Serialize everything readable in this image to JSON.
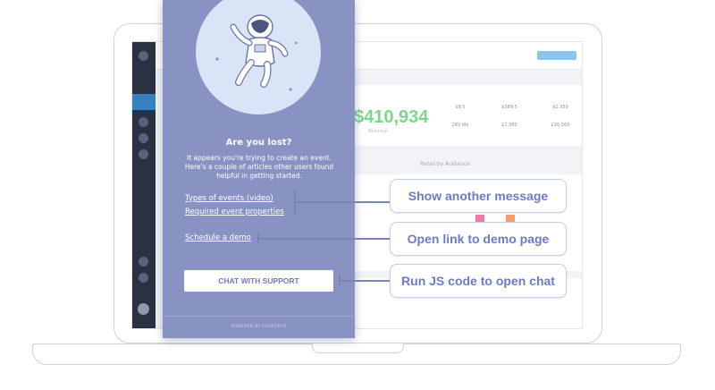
{
  "dashboard": {
    "revenue_value": "$410,934",
    "revenue_caption": "Revenue",
    "section_title": "Retail by Audience",
    "stats": [
      "$8.5",
      "$389.5",
      "$1,350",
      "289 fits",
      "£1,385",
      "£16,563"
    ]
  },
  "help_panel": {
    "title": "Are you lost?",
    "description": "It appears you're trying to create an event. Here's a couple of articles other users found helpful in getting started.",
    "links": [
      "Types of events (video)",
      "Required event properties",
      "Schedule a demo"
    ],
    "chat_button_label": "CHAT WITH SUPPORT",
    "powered_by": "POWERED BY TOOLTIP.IO"
  },
  "callouts": [
    "Show another message",
    "Open link to demo page",
    "Run JS code to open chat"
  ],
  "colors": {
    "panel_bg": "#8892c3",
    "accent": "#6f7bc0",
    "callout_border": "#c9cde6",
    "revenue_green": "#7ed68b"
  }
}
